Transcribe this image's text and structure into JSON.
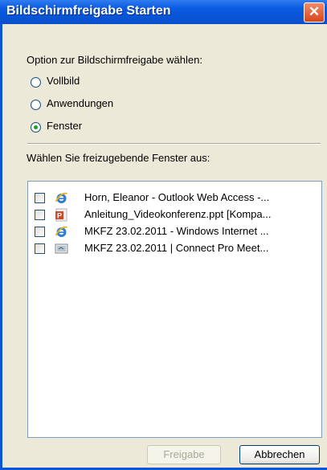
{
  "window": {
    "title": "Bildschirmfreigabe Starten"
  },
  "options": {
    "heading": "Option zur Bildschirmfreigabe wählen:",
    "items": [
      {
        "label": "Vollbild",
        "checked": false
      },
      {
        "label": "Anwendungen",
        "checked": false
      },
      {
        "label": "Fenster",
        "checked": true
      }
    ]
  },
  "windows_list": {
    "heading": "Wählen Sie freizugebende Fenster aus:",
    "items": [
      {
        "label": "Horn, Eleanor - Outlook Web Access -...",
        "icon": "internet-explorer-icon",
        "checked": false
      },
      {
        "label": "Anleitung_Videokonferenz.ppt [Kompa...",
        "icon": "powerpoint-icon",
        "checked": false
      },
      {
        "label": "MKFZ 23.02.2011 - Windows Internet ...",
        "icon": "internet-explorer-icon",
        "checked": false
      },
      {
        "label": "MKFZ 23.02.2011 | Connect Pro Meet...",
        "icon": "connect-pro-icon",
        "checked": false
      }
    ]
  },
  "buttons": {
    "share": "Freigabe",
    "cancel": "Abbrechen"
  },
  "colors": {
    "titlebar": "#0a5ae0",
    "close": "#d8461a",
    "dialog_bg": "#ece9d8"
  }
}
